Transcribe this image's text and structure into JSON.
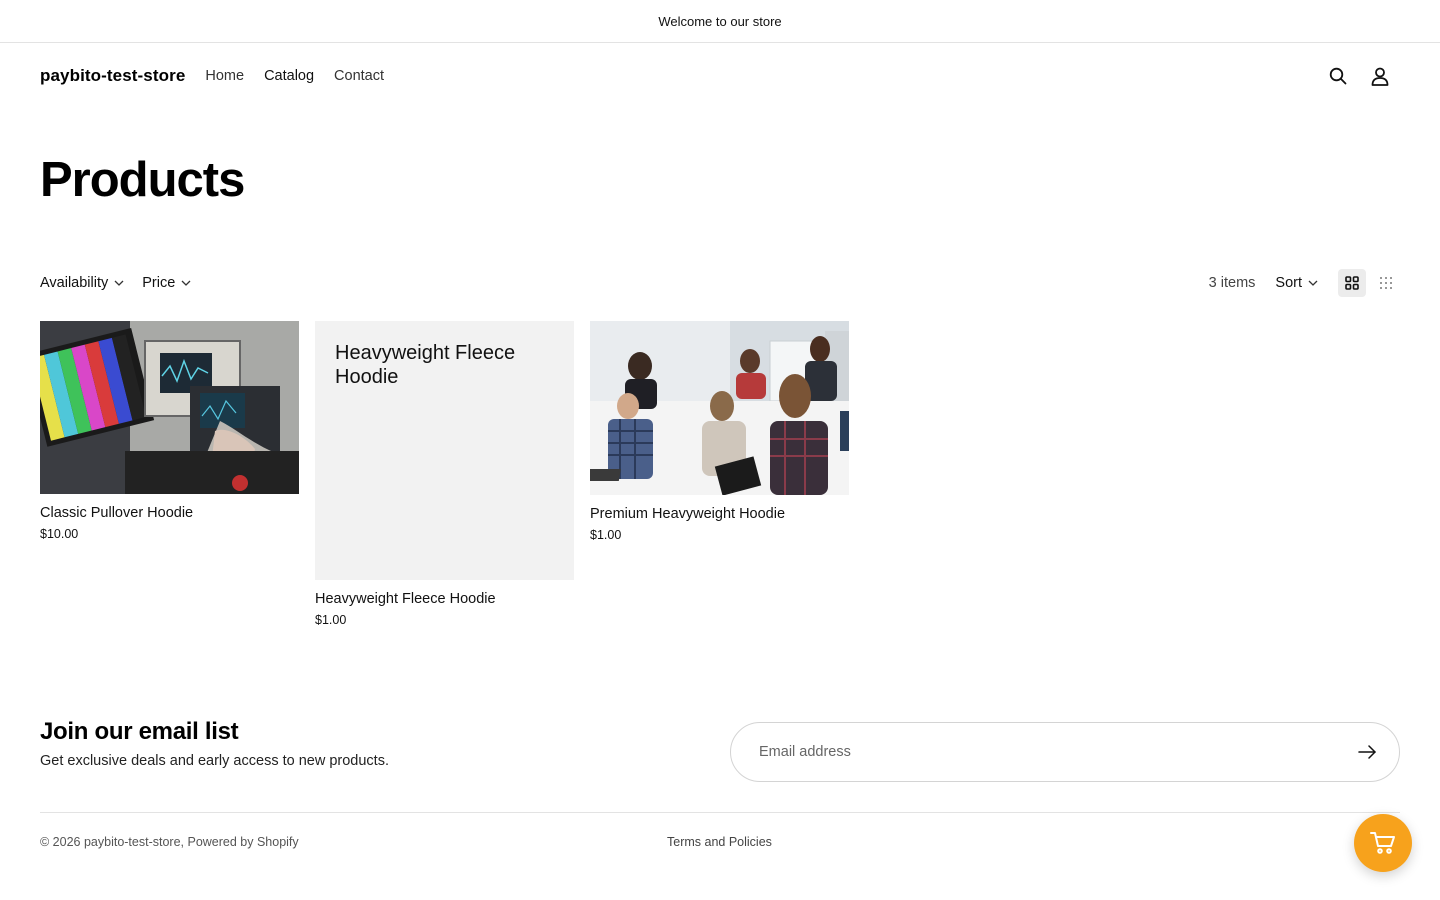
{
  "announcement": "Welcome to our store",
  "header": {
    "logo": "paybito-test-store",
    "nav": [
      {
        "label": "Home"
      },
      {
        "label": "Catalog"
      },
      {
        "label": "Contact"
      }
    ],
    "icons": [
      "search-icon",
      "account-icon"
    ]
  },
  "page": {
    "title": "Products"
  },
  "toolbar": {
    "filters": [
      {
        "label": "Availability"
      },
      {
        "label": "Price"
      }
    ],
    "count": "3 items",
    "sort_label": "Sort",
    "view_modes": [
      "grid-large-icon",
      "grid-small-icon"
    ]
  },
  "products": [
    {
      "name": "Classic Pullover Hoodie",
      "price": "$10.00",
      "image": "electronics-lab-photo"
    },
    {
      "name": "Heavyweight Fleece Hoodie",
      "price": "$1.00",
      "image": "placeholder",
      "placeholder_text": "Heavyweight Fleece Hoodie"
    },
    {
      "name": "Premium Heavyweight Hoodie",
      "price": "$1.00",
      "image": "office-meeting-photo"
    }
  ],
  "newsletter": {
    "title": "Join our email list",
    "subtitle": "Get exclusive deals and early access to new products.",
    "placeholder": "Email address"
  },
  "footer": {
    "copyright": "© 2026 paybito-test-store, Powered by Shopify",
    "policies": "Terms and Policies"
  },
  "colors": {
    "accent_fab": "#f7a21c",
    "placeholder_bg": "#f2f2f2"
  }
}
